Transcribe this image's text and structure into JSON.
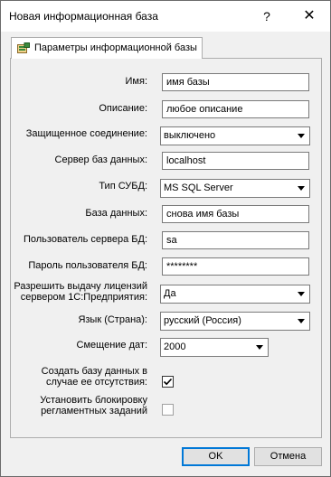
{
  "window": {
    "title": "Новая информационная база",
    "help": "?",
    "close": "✕"
  },
  "tab": {
    "label": "Параметры информационной базы"
  },
  "form": {
    "name_label": "Имя:",
    "name_value": "имя базы",
    "description_label": "Описание:",
    "description_value": "любое описание",
    "secure_label": "Защищенное соединение:",
    "secure_value": "выключено",
    "server_label": "Сервер баз данных:",
    "server_value": "localhost",
    "dbms_label": "Тип СУБД:",
    "dbms_value": "MS SQL Server",
    "database_label": "База данных:",
    "database_value": "снова имя базы",
    "db_user_label": "Пользователь сервера БД:",
    "db_user_value": "sa",
    "db_password_label": "Пароль пользователя БД:",
    "db_password_value": "********",
    "license_label_1": "Разрешить выдачу лицензий",
    "license_label_2": "сервером 1С:Предприятия:",
    "license_value": "Да",
    "language_label": "Язык (Страна):",
    "language_value": "русский (Россия)",
    "offset_label": "Смещение дат:",
    "offset_value": "2000",
    "create_db_label_1": "Создать базу данных в",
    "create_db_label_2": "случае ее отсутствия:",
    "create_db_checked": true,
    "lock_label_1": "Установить блокировку",
    "lock_label_2": "регламентных заданий",
    "lock_checked": false
  },
  "buttons": {
    "ok": "OK",
    "cancel": "Отмена"
  }
}
